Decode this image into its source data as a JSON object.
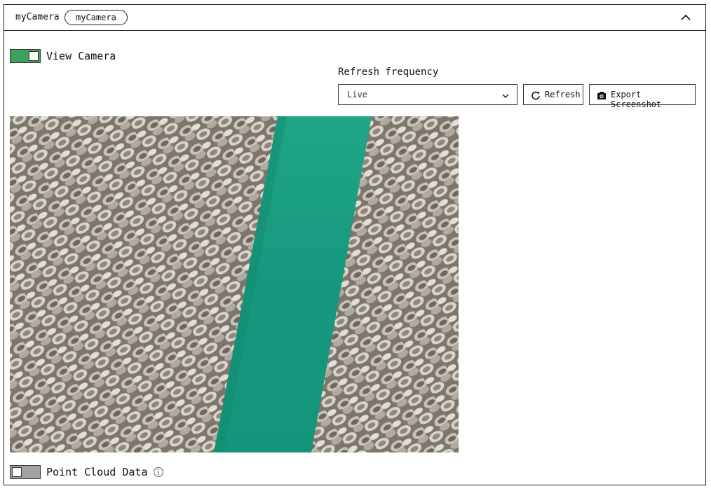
{
  "panel": {
    "title": "myCamera",
    "chip": "myCamera",
    "collapse_icon": "chevron-up-icon"
  },
  "view_camera": {
    "label": "View Camera",
    "enabled": true
  },
  "refresh": {
    "label": "Refresh frequency",
    "selected": "Live",
    "refresh_button": "Refresh",
    "export_button": "Export Screenshot"
  },
  "camera_feed": {
    "description_icon": "camera-feed-image"
  },
  "point_cloud": {
    "label": "Point Cloud Data",
    "enabled": false,
    "info_icon": "info-icon"
  },
  "colors": {
    "toggle_on": "#3ea05c",
    "toggle_off": "#a3a3a3",
    "tape": "#17a085"
  }
}
